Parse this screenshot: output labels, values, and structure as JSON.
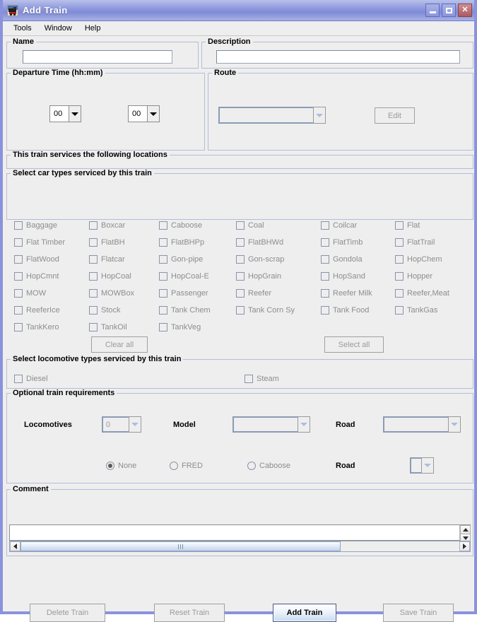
{
  "window": {
    "title": "Add Train",
    "icon": "train-icon",
    "buttons": {
      "minimize": "minimize-icon",
      "maximize": "maximize-icon",
      "close": "close-icon"
    }
  },
  "menubar": {
    "items": [
      {
        "label": "Tools"
      },
      {
        "label": "Window"
      },
      {
        "label": "Help"
      }
    ]
  },
  "name_group": {
    "legend": "Name",
    "value": "",
    "placeholder": ""
  },
  "description_group": {
    "legend": "Description",
    "value": "",
    "placeholder": ""
  },
  "departure_group": {
    "legend": "Departure Time (hh:mm)",
    "hours": "00",
    "minutes": "00"
  },
  "route_group": {
    "legend": "Route",
    "selected": "",
    "edit_label": "Edit"
  },
  "locations_group": {
    "legend": "This train services the following locations"
  },
  "car_types_group": {
    "legend": "Select car types serviced by this train",
    "clear_all_label": "Clear all",
    "select_all_label": "Select all",
    "columns": [
      [
        "Baggage",
        "Flat Timber",
        "FlatWood",
        "HopCmnt",
        "MOW",
        "ReeferIce",
        "TankKero"
      ],
      [
        "Boxcar",
        "FlatBH",
        "Flatcar",
        "HopCoal",
        "MOWBox",
        "Stock",
        "TankOil"
      ],
      [
        "Caboose",
        "FlatBHPp",
        "Gon-pipe",
        "HopCoal-E",
        "Passenger",
        "Tank Chem",
        "TankVeg"
      ],
      [
        "Coal",
        "FlatBHWd",
        "Gon-scrap",
        "HopGrain",
        "Reefer",
        "Tank Corn Sy"
      ],
      [
        "Coilcar",
        "FlatTimb",
        "Gondola",
        "HopSand",
        "Reefer Milk",
        "Tank Food"
      ],
      [
        "Flat",
        "FlatTrail",
        "HopChem",
        "Hopper",
        "Reefer,Meat",
        "TankGas"
      ]
    ]
  },
  "loco_types_group": {
    "legend": "Select locomotive types serviced by this train",
    "diesel_label": "Diesel",
    "steam_label": "Steam"
  },
  "optional_group": {
    "legend": "Optional train requirements",
    "locomotives_label": "Locomotives",
    "locomotives_value": "0",
    "model_label": "Model",
    "model_value": "",
    "road_label": "Road",
    "road_value": "",
    "caboose_road_label": "Road",
    "caboose_road_value": "",
    "radios": [
      {
        "label": "None",
        "checked": true
      },
      {
        "label": "FRED",
        "checked": false
      },
      {
        "label": "Caboose",
        "checked": false
      }
    ]
  },
  "comment_group": {
    "legend": "Comment",
    "value": ""
  },
  "footer": {
    "delete_label": "Delete Train",
    "reset_label": "Reset Train",
    "add_label": "Add Train",
    "save_label": "Save Train"
  },
  "colors": {
    "window_border": "#8a92dd",
    "titlebar": "#8f9ade",
    "panel_bg": "#eeeeee",
    "group_border": "#b4bcd8",
    "disabled_text": "#8d8d8d",
    "default_button": "#c9daf2"
  }
}
